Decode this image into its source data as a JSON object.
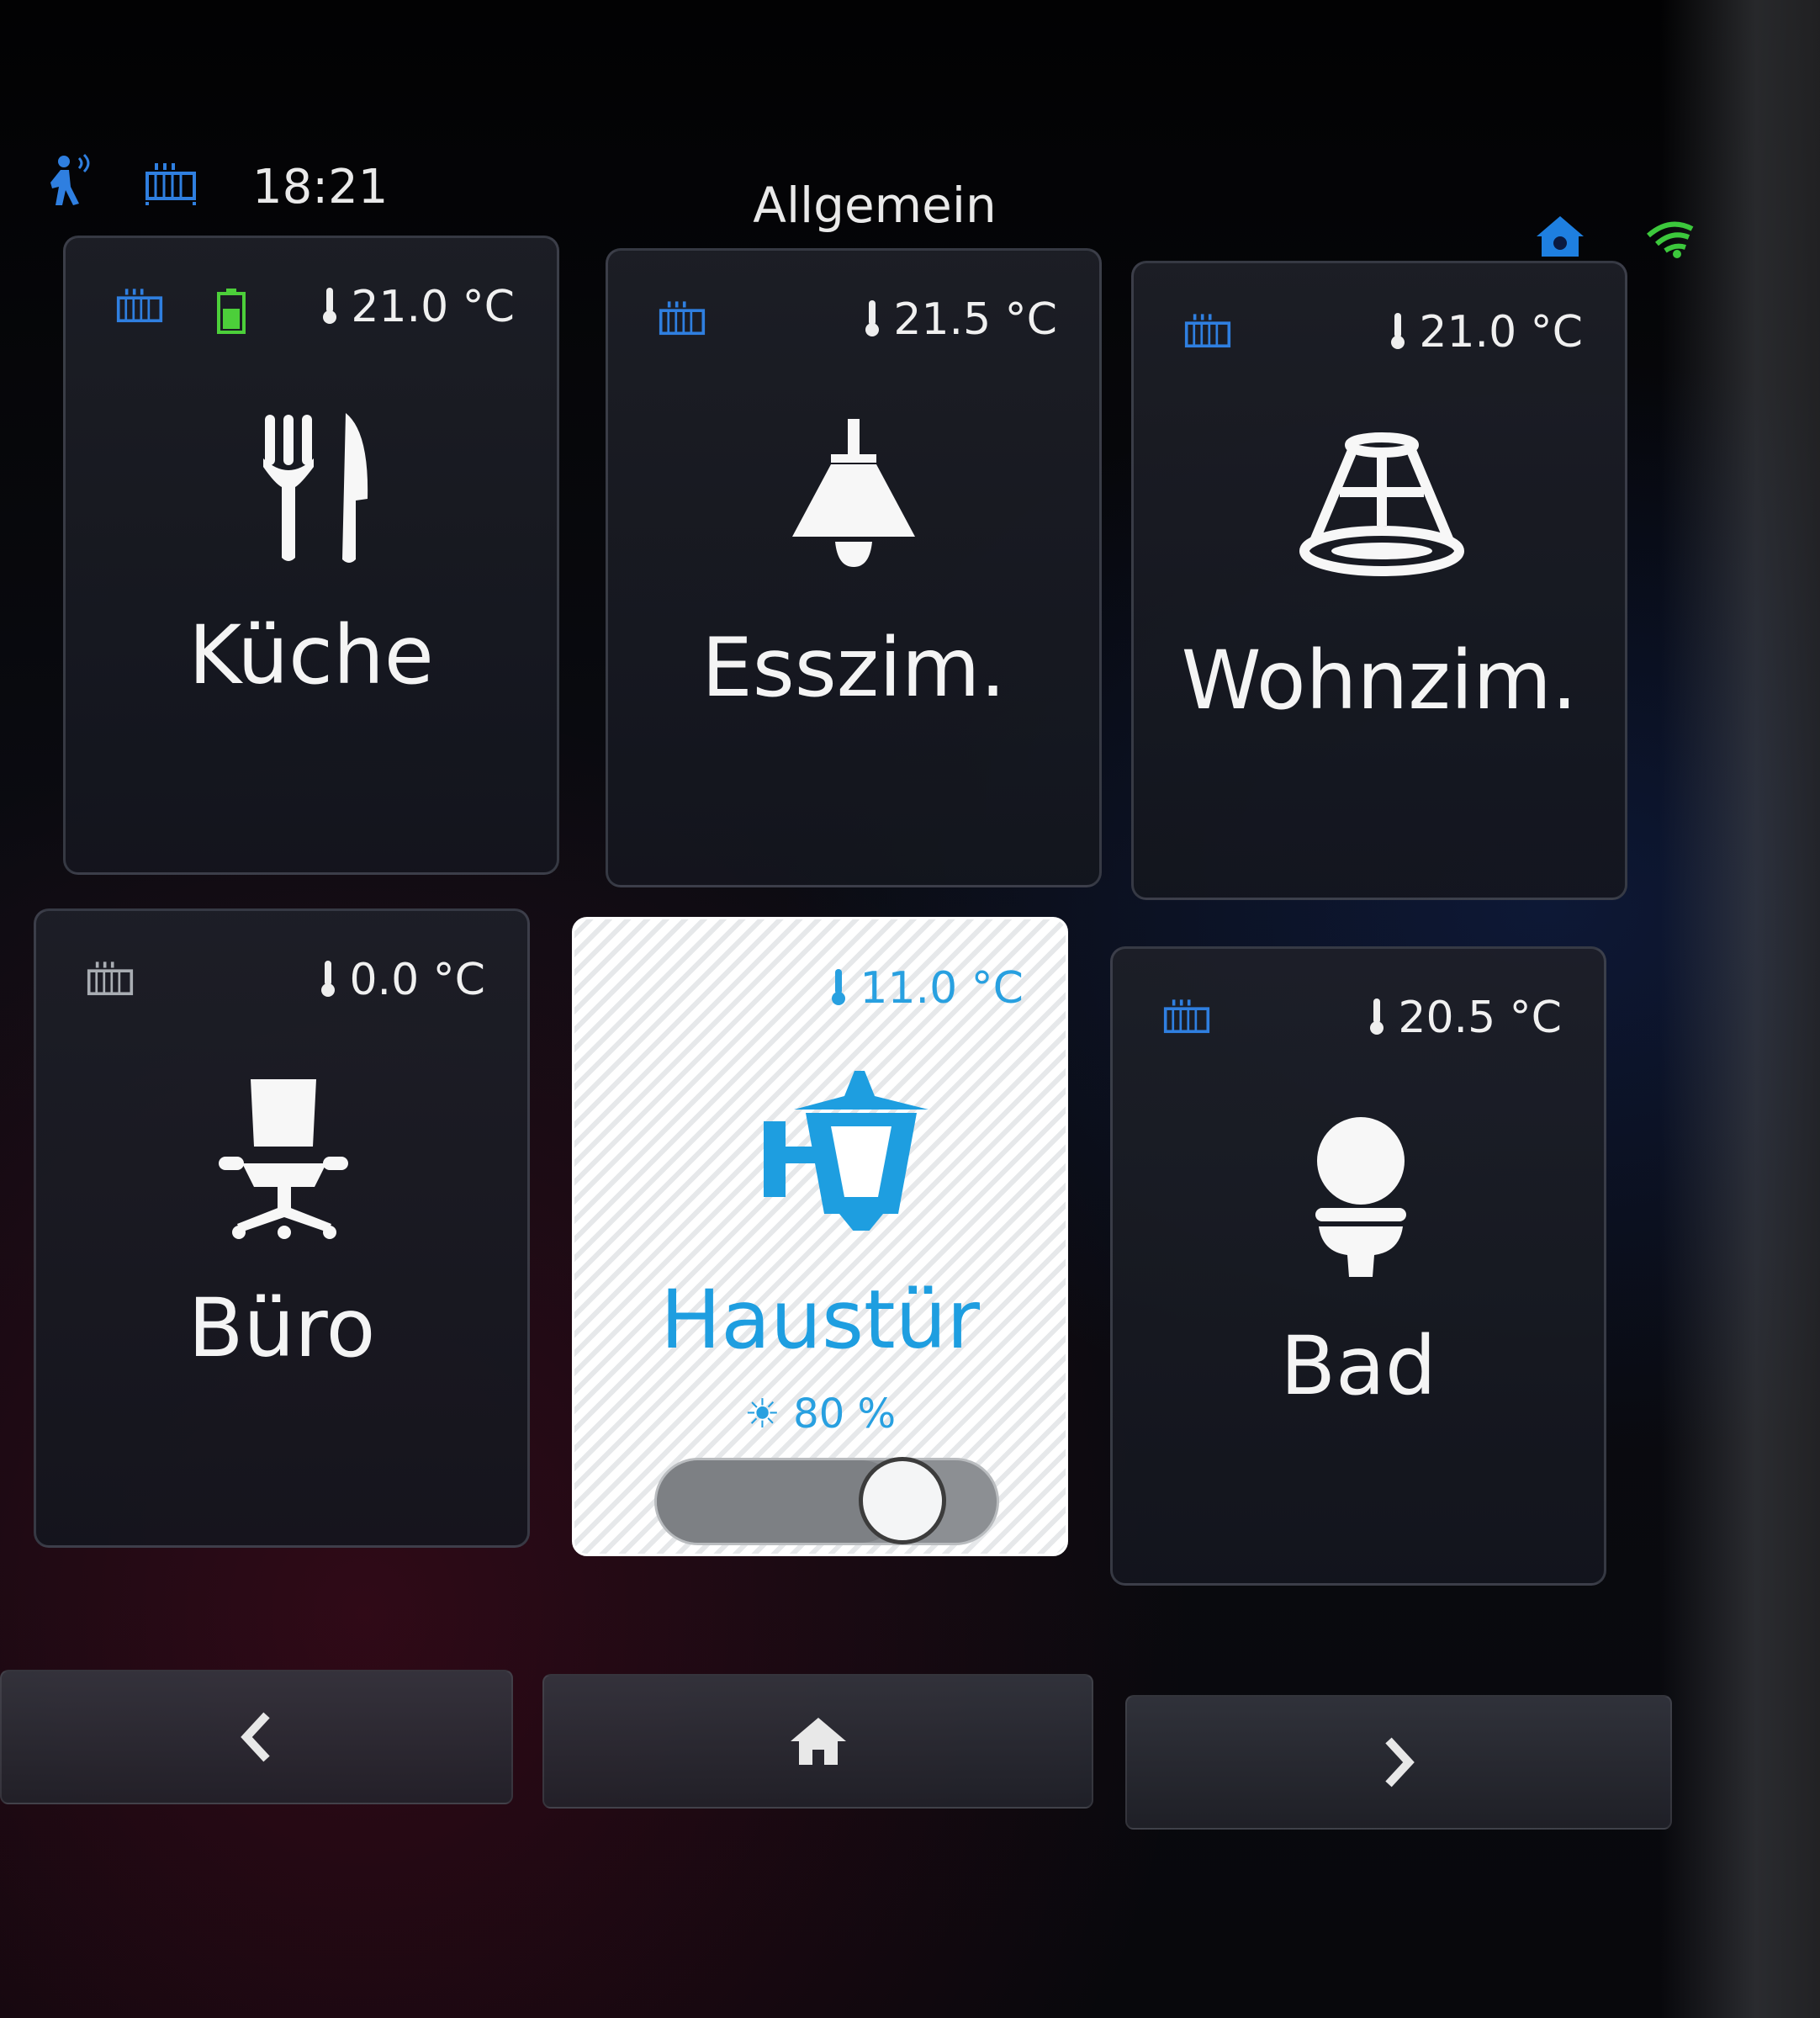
{
  "status_bar": {
    "time": "18:21",
    "title": "Allgemein",
    "icons": [
      "presence-icon",
      "heating-icon",
      "home-network-icon",
      "wifi-icon"
    ]
  },
  "tiles": [
    {
      "label": "Küche",
      "temp": "21.0 °C",
      "icon": "cutlery-icon",
      "heating_active": true,
      "battery": true
    },
    {
      "label": "Esszim.",
      "temp": "21.5 °C",
      "icon": "pendant-lamp-icon",
      "heating_active": true
    },
    {
      "label": "Wohnzim.",
      "temp": "21.0 °C",
      "icon": "chandelier-icon",
      "heating_active": true
    },
    {
      "label": "Büro",
      "temp": "0.0 °C",
      "icon": "office-chair-icon",
      "heating_active": false
    },
    {
      "label": "Haustür",
      "temp": "11.0 °C",
      "icon": "wall-lantern-icon",
      "brightness": "80 %",
      "brightness_value": 80,
      "active": true
    },
    {
      "label": "Bad",
      "temp": "20.5 °C",
      "icon": "toilet-icon",
      "heating_active": true
    }
  ],
  "nav": {
    "prev": "chevron-left-icon",
    "home": "home-icon",
    "next": "chevron-right-icon"
  },
  "colors": {
    "accent_blue": "#1e9ee0",
    "wifi_green": "#3cc83c",
    "battery_green": "#4ccf3a",
    "heating_inactive": "#a9adb3"
  }
}
